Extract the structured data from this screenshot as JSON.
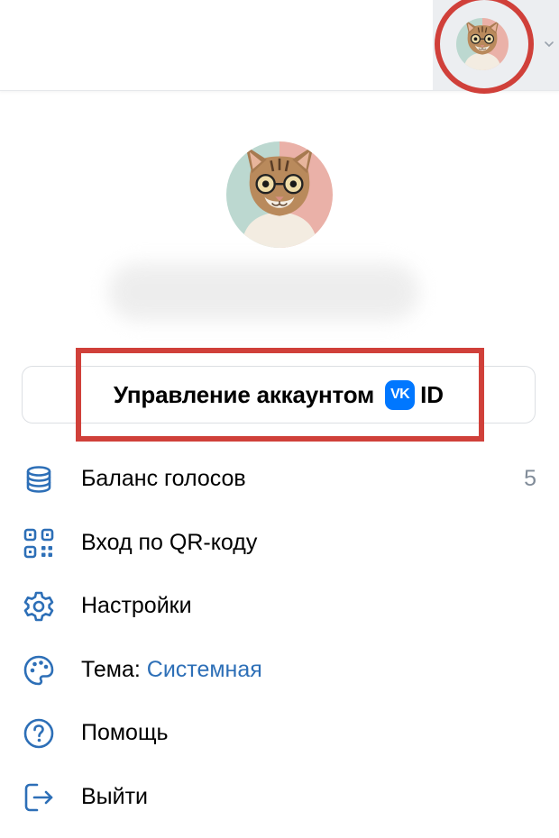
{
  "colors": {
    "accent": "#2d6fb7",
    "annotation": "#d0403a",
    "vk_blue": "#0077ff",
    "muted": "#818c99"
  },
  "header": {
    "avatar_icon": "user-avatar-cat",
    "caret_icon": "chevron-down-icon"
  },
  "profile": {
    "avatar_icon": "user-avatar-cat"
  },
  "manage_account": {
    "label": "Управление аккаунтом",
    "logo_text": "VK",
    "id_label": "ID"
  },
  "menu": [
    {
      "icon": "database-icon",
      "label": "Баланс голосов",
      "count": "5"
    },
    {
      "icon": "qr-code-icon",
      "label": "Вход по QR-коду"
    },
    {
      "icon": "gear-icon",
      "label": "Настройки"
    },
    {
      "icon": "palette-icon",
      "label": "Тема:",
      "value": "Системная"
    },
    {
      "icon": "help-icon",
      "label": "Помощь"
    },
    {
      "icon": "logout-icon",
      "label": "Выйти"
    }
  ]
}
